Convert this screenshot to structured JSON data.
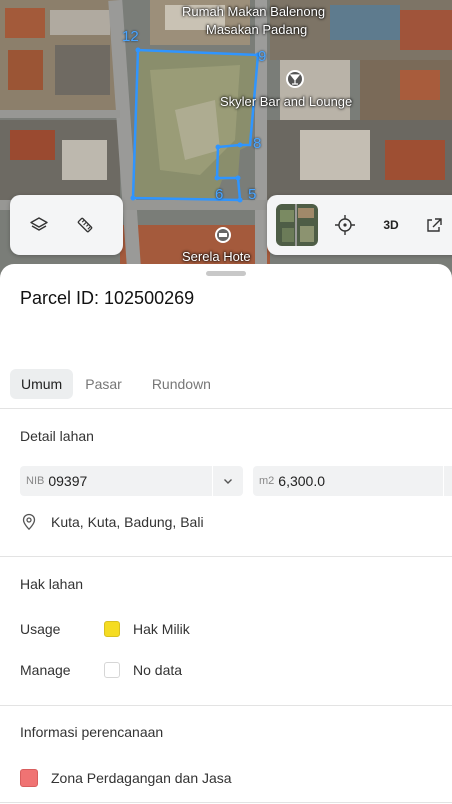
{
  "map": {
    "labels": {
      "restaurant_line1": "Rumah Makan Balenong",
      "restaurant_line2": "Masakan Padang",
      "bar": "Skyler Bar and Lounge",
      "hotel": "Serela Hote"
    },
    "vertex_labels": [
      "12",
      "9",
      "8",
      "5",
      "6"
    ],
    "threed_label": "3D",
    "colors": {
      "parcel_outline": "#2f95ff",
      "vertex_label": "#49a4ff"
    },
    "icons": [
      "layers-icon",
      "measure-ruler-icon",
      "satellite-thumbnail",
      "locate-crosshair-icon",
      "3d-icon",
      "share-icon",
      "bar-pin-icon",
      "hotel-pin-icon"
    ]
  },
  "sheet": {
    "parcel_id": "Parcel ID: 102500269",
    "tabs": [
      {
        "label": "Umum",
        "active": true
      },
      {
        "label": "Pasar",
        "active": false
      },
      {
        "label": "Rundown",
        "active": false
      }
    ],
    "detail": {
      "title": "Detail lahan",
      "nib_prefix": "NIB",
      "nib_value": "09397",
      "area_prefix": "m2",
      "area_value": "6,300.0",
      "location": "Kuta, Kuta, Badung, Bali"
    },
    "hak": {
      "title": "Hak lahan",
      "usage_label": "Usage",
      "usage_value": "Hak Milik",
      "usage_color": "#f5dc22",
      "manage_label": "Manage",
      "manage_value": "No data"
    },
    "planning": {
      "title": "Informasi perencanaan",
      "zone": "Zona Perdagangan dan Jasa",
      "zone_color": "#f07373"
    }
  }
}
